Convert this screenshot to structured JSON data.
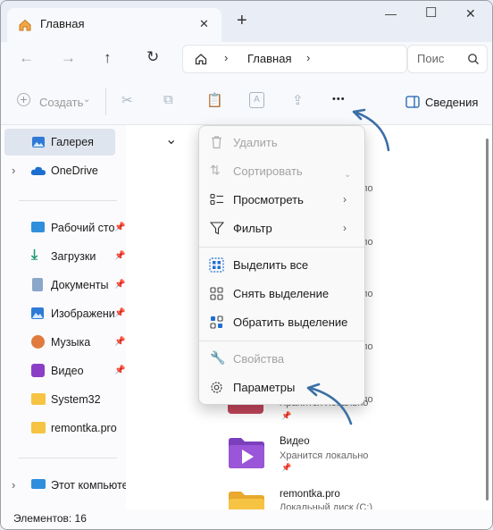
{
  "window": {
    "tab_title": "Главная",
    "new_tab": "+",
    "controls": {
      "minimize": "—",
      "maximize": "☐",
      "close": "✕"
    }
  },
  "navigation": {
    "breadcrumb": "Главная",
    "search_placeholder": "Поис"
  },
  "toolbar": {
    "create_label": "Создать",
    "more_label": "•••",
    "details_label": "Сведения"
  },
  "sidebar": {
    "items": [
      {
        "label": "Галерея",
        "selected": true
      },
      {
        "label": "OneDrive"
      },
      {
        "label": "Рабочий сто",
        "pinned": true
      },
      {
        "label": "Загрузки",
        "pinned": true
      },
      {
        "label": "Документы",
        "pinned": true
      },
      {
        "label": "Изображени",
        "pinned": true
      },
      {
        "label": "Музыка",
        "pinned": true
      },
      {
        "label": "Видео",
        "pinned": true
      },
      {
        "label": "System32"
      },
      {
        "label": "remontka.pro"
      },
      {
        "label": "Этот компьюте"
      }
    ]
  },
  "context_menu": {
    "items": [
      {
        "label": "Удалить",
        "icon": "trash-icon",
        "disabled": true
      },
      {
        "label": "Сортировать",
        "icon": "sort-icon",
        "disabled": true
      },
      {
        "label": "Просмотреть",
        "icon": "view-icon",
        "submenu": true
      },
      {
        "label": "Фильтр",
        "icon": "filter-icon",
        "submenu": true
      },
      {
        "label": "Выделить все",
        "icon": "select-all-icon"
      },
      {
        "label": "Снять выделение",
        "icon": "select-none-icon"
      },
      {
        "label": "Обратить выделение",
        "icon": "invert-selection-icon"
      },
      {
        "label": "Свойства",
        "icon": "wrench-icon",
        "disabled": true
      },
      {
        "label": "Параметры",
        "icon": "gear-icon"
      }
    ]
  },
  "content": {
    "partial_text": [
      "ло",
      "ло",
      "ло",
      "ло",
      "ло"
    ],
    "files": [
      {
        "name": "Видео",
        "status": "Хранится локально"
      },
      {
        "name": "remontka.pro",
        "status": "Локальный диск (C:)"
      }
    ],
    "partial_status": "Хранится локально"
  },
  "statusbar": {
    "items_count": "Элементов: 16"
  },
  "colors": {
    "accent": "#1f6fd1",
    "annotation_arrow": "#3b6fa6"
  }
}
